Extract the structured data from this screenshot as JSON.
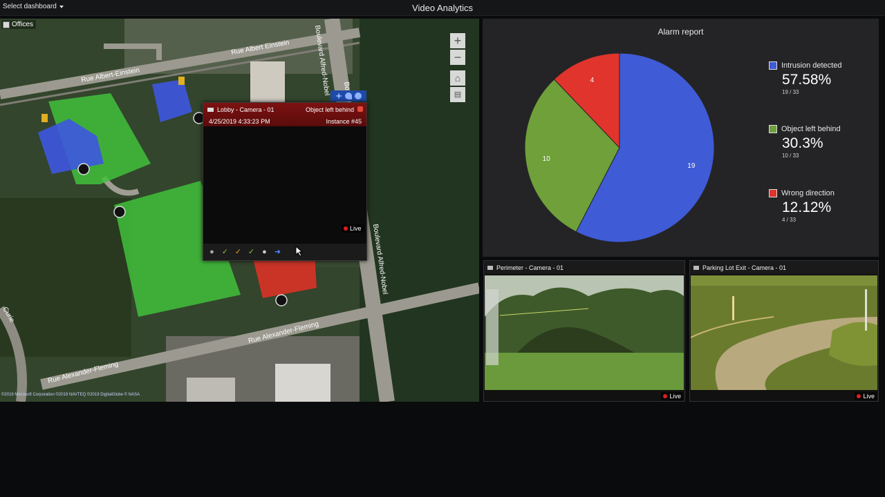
{
  "topbar": {
    "dashboard_select": "Select dashboard",
    "title": "Video Analytics"
  },
  "map": {
    "layer_label": "Offices",
    "streets": [
      "Rue Albert Einstein",
      "Rue Albert-Einstein",
      "Boulevard Alfred-Nobel",
      "Boulevard Alfred-Nobel",
      "Rue Alexander-Fleming",
      "Rue Alexander-Fleming",
      "Boulevard",
      "Curie"
    ],
    "controls": {
      "zoom_in": "+",
      "zoom_out": "−",
      "home": "⌂",
      "layers": "▤"
    },
    "copyright": "©2019 Microsoft Corporation ©2019 NAVTEQ ©2019 DigitalGlobe © NASA"
  },
  "popup": {
    "camera": "Lobby - Camera - 01",
    "event": "Object left behind",
    "timestamp": "4/25/2019 4:33:23 PM",
    "instance": "Instance #45",
    "live": "Live",
    "actions": [
      "search-icon",
      "acknowledge-icon",
      "acknowledge-alt-icon",
      "forward-icon",
      "snooze-icon",
      "forward-arrow-icon"
    ]
  },
  "alarm_report": {
    "title": "Alarm report",
    "legend": [
      {
        "label": "Intrusion detected",
        "percent": "57.58%",
        "fraction": "19 / 33",
        "color": "#3f5bd6"
      },
      {
        "label": "Object left behind",
        "percent": "30.3%",
        "fraction": "10 / 33",
        "color": "#6fa03a"
      },
      {
        "label": "Wrong direction",
        "percent": "12.12%",
        "fraction": "4 / 33",
        "color": "#e0342c"
      }
    ]
  },
  "chart_data": {
    "type": "pie",
    "title": "Alarm report",
    "categories": [
      "Intrusion detected",
      "Object left behind",
      "Wrong direction"
    ],
    "values": [
      19,
      10,
      4
    ],
    "colors": [
      "#3f5bd6",
      "#6fa03a",
      "#e0342c"
    ],
    "legend": "right"
  },
  "cameras": [
    {
      "name": "Perimeter - Camera - 01",
      "live": "Live"
    },
    {
      "name": "Parking Lot Exit - Camera - 01",
      "live": "Live"
    }
  ]
}
